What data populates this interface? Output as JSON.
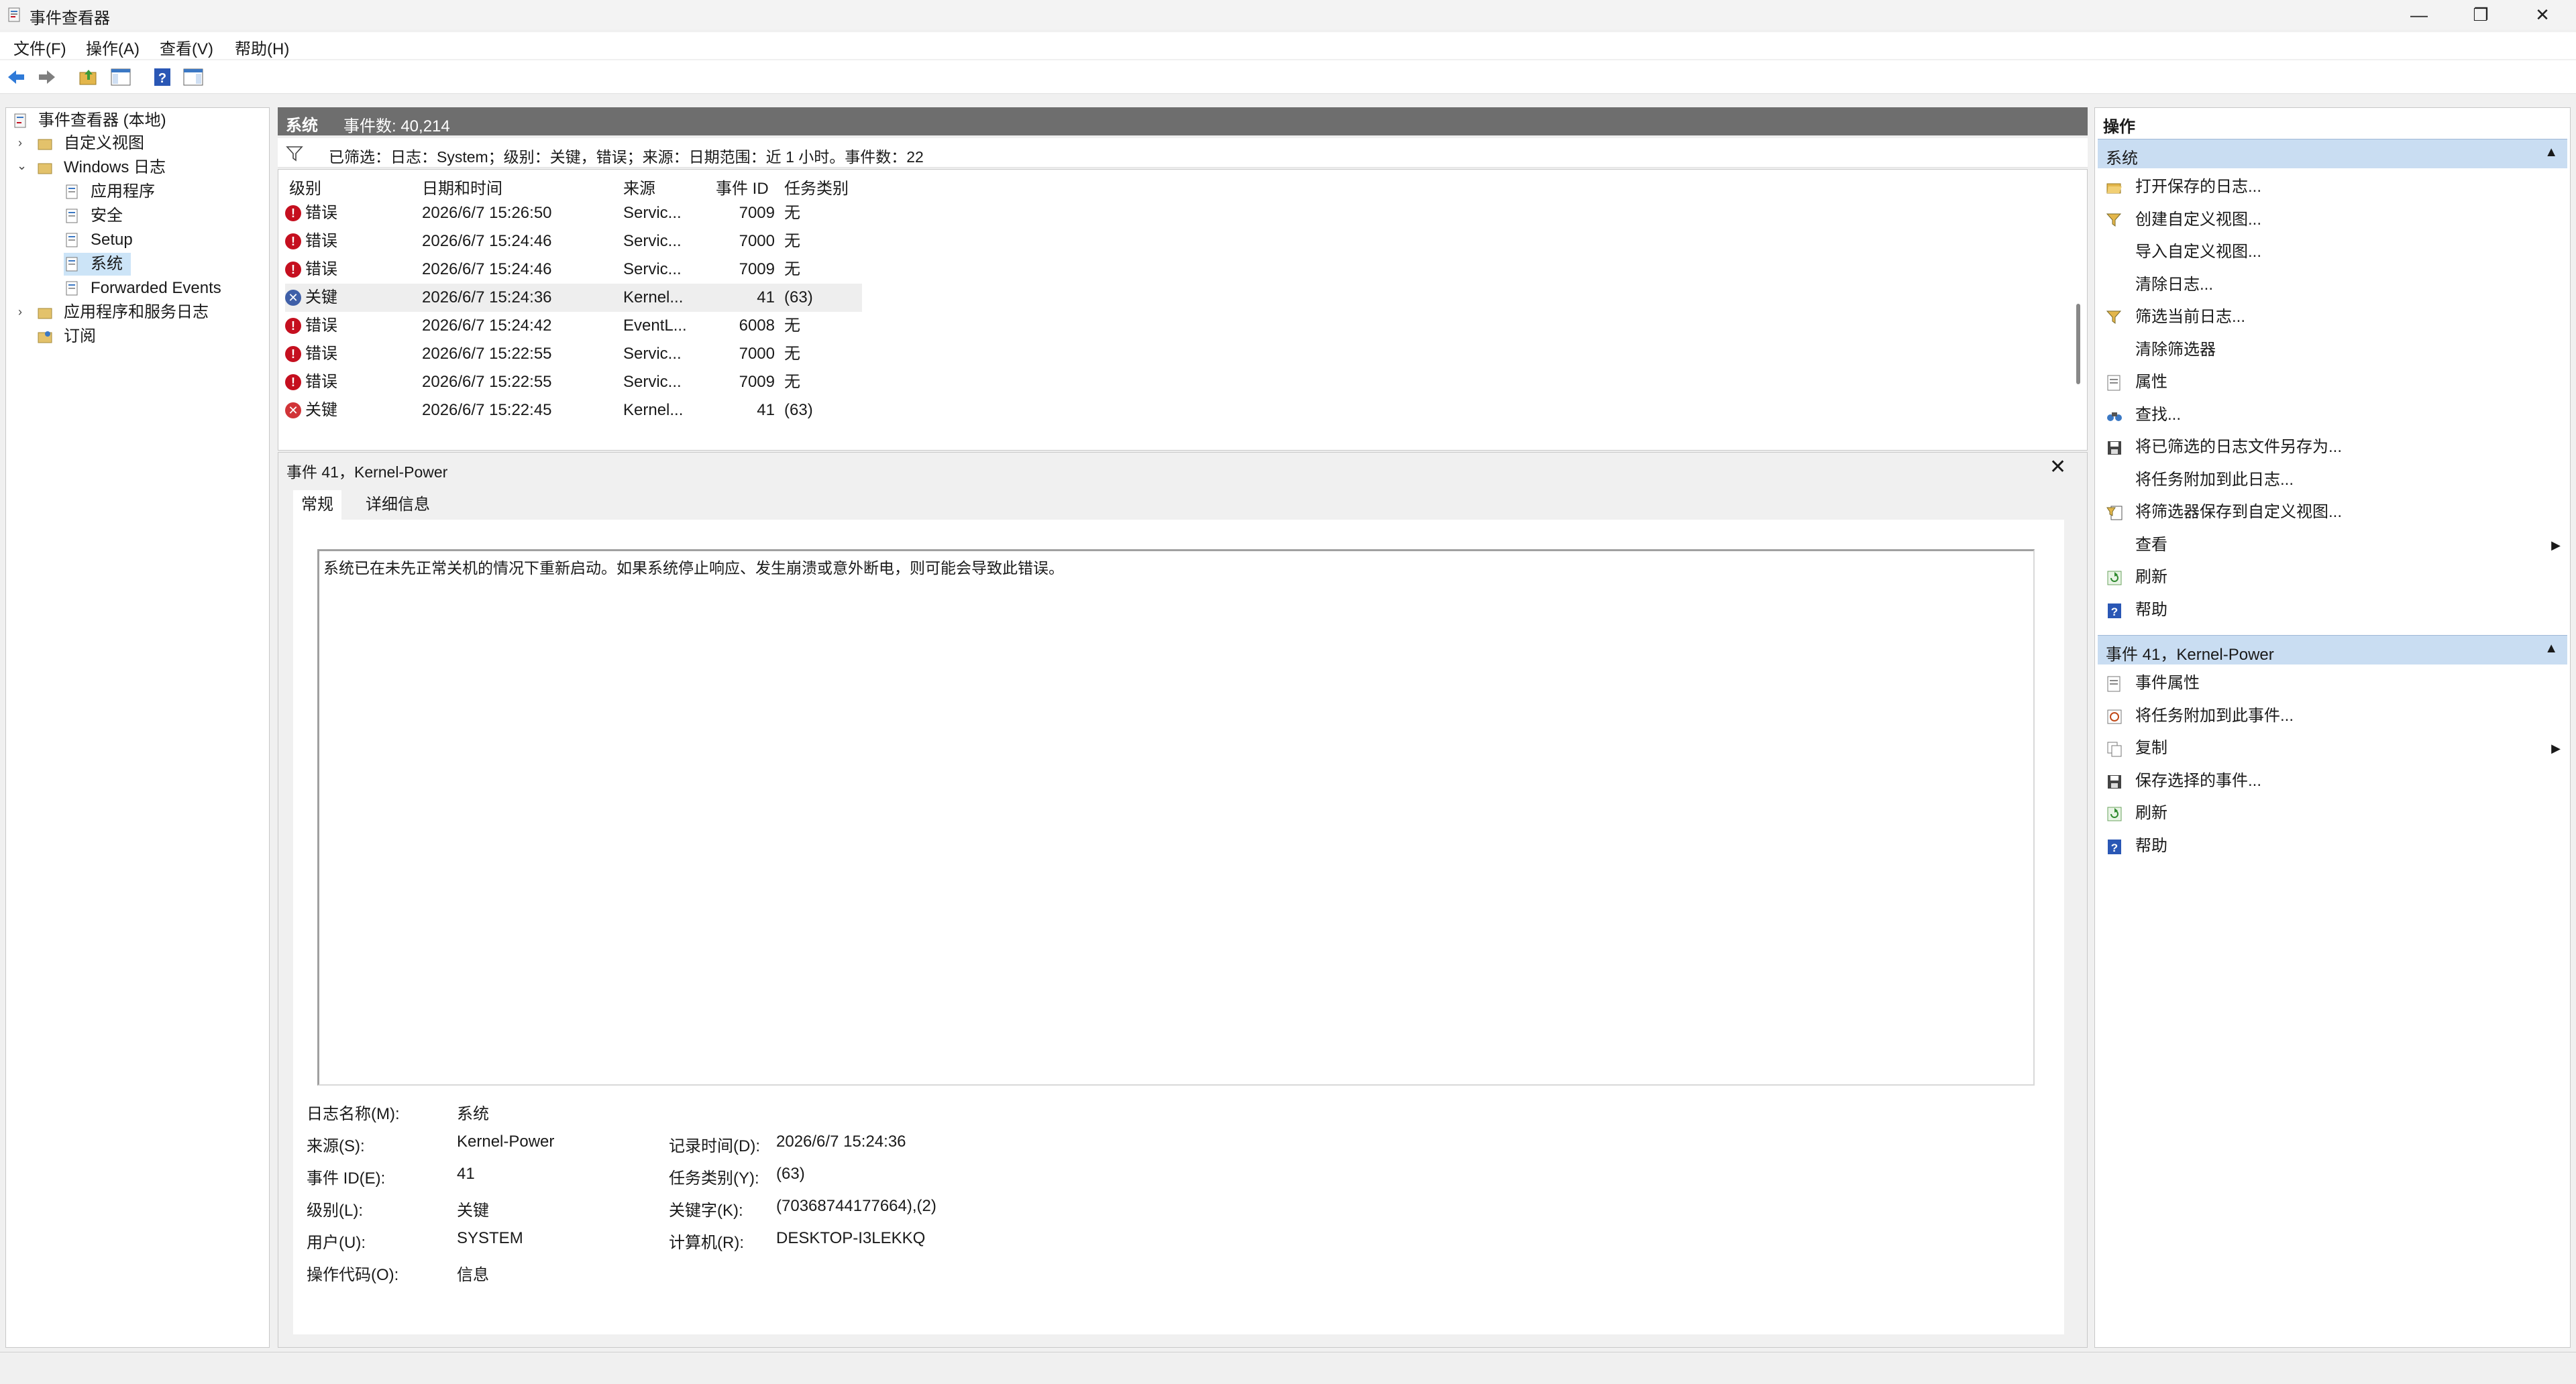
{
  "window": {
    "title": "事件查看器",
    "min_glyph": "—",
    "max_glyph": "❐",
    "close_glyph": "✕"
  },
  "menu": [
    "文件(F)",
    "操作(A)",
    "查看(V)",
    "帮助(H)"
  ],
  "toolbar": [
    "back-icon",
    "forward-icon",
    "up-folder-icon",
    "show-hide-tree-icon",
    "help-icon",
    "show-hide-action-pane-icon"
  ],
  "tree": {
    "root": "事件查看器 (本地)",
    "custom_views": "自定义视图",
    "windows_logs": "Windows 日志",
    "application": "应用程序",
    "security": "安全",
    "setup": "Setup",
    "system": "系统",
    "forwarded": "Forwarded Events",
    "app_service_logs": "应用程序和服务日志",
    "subscriptions": "订阅"
  },
  "middle": {
    "title": "系统",
    "count": "事件数: 40,214",
    "filter": "已筛选：日志：System；级别：关键，错误；来源：日期范围：近 1 小时。事件数：22",
    "columns": {
      "level": "级别",
      "datetime": "日期和时间",
      "source": "来源",
      "event_id": "事件 ID",
      "task": "任务类别"
    },
    "rows": [
      {
        "level": "错误",
        "kind": "error",
        "datetime": "2026/6/7 15:26:50",
        "source": "Servic...",
        "id": "7009",
        "task": "无"
      },
      {
        "level": "错误",
        "kind": "error",
        "datetime": "2026/6/7 15:24:46",
        "source": "Servic...",
        "id": "7000",
        "task": "无"
      },
      {
        "level": "错误",
        "kind": "error",
        "datetime": "2026/6/7 15:24:46",
        "source": "Servic...",
        "id": "7009",
        "task": "无"
      },
      {
        "level": "关键",
        "kind": "critical",
        "datetime": "2026/6/7 15:24:36",
        "source": "Kernel...",
        "id": "41",
        "task": "(63)"
      },
      {
        "level": "错误",
        "kind": "error",
        "datetime": "2026/6/7 15:24:42",
        "source": "EventL...",
        "id": "6008",
        "task": "无"
      },
      {
        "level": "错误",
        "kind": "error",
        "datetime": "2026/6/7 15:22:55",
        "source": "Servic...",
        "id": "7000",
        "task": "无"
      },
      {
        "level": "错误",
        "kind": "error",
        "datetime": "2026/6/7 15:22:55",
        "source": "Servic...",
        "id": "7009",
        "task": "无"
      },
      {
        "level": "关键",
        "kind": "critical",
        "datetime": "2026/6/7 15:22:45",
        "source": "Kernel...",
        "id": "41",
        "task": "(63)"
      }
    ]
  },
  "detail": {
    "title": "事件 41，Kernel-Power",
    "close": "✕",
    "tab_general": "常规",
    "tab_details": "详细信息",
    "description": "系统已在未先正常关机的情况下重新启动。如果系统停止响应、发生崩溃或意外断电，则可能会导致此错误。",
    "log_name_label": "日志名称(M):",
    "log_name": "系统",
    "source_label": "来源(S):",
    "source": "Kernel-Power",
    "logged_label": "记录时间(D):",
    "logged": "2026/6/7 15:24:36",
    "event_id_label": "事件 ID(E):",
    "event_id": "41",
    "task_label": "任务类别(Y):",
    "task": "(63)",
    "level_label": "级别(L):",
    "level": "关键",
    "keywords_label": "关键字(K):",
    "keywords": "(70368744177664),(2)",
    "user_label": "用户(U):",
    "user": "SYSTEM",
    "computer_label": "计算机(R):",
    "computer": "DESKTOP-I3LEKKQ",
    "opcode_label": "操作代码(O):",
    "opcode": "信息"
  },
  "actions": {
    "title": "操作",
    "section1": "系统",
    "section1_items": [
      {
        "label": "打开保存的日志...",
        "icon": "open-folder-icon"
      },
      {
        "label": "创建自定义视图...",
        "icon": "funnel-icon"
      },
      {
        "label": "导入自定义视图...",
        "icon": ""
      },
      {
        "label": "清除日志...",
        "icon": ""
      },
      {
        "label": "筛选当前日志...",
        "icon": "funnel-icon"
      },
      {
        "label": "清除筛选器",
        "icon": ""
      },
      {
        "label": "属性",
        "icon": "properties-icon"
      },
      {
        "label": "查找...",
        "icon": "binoculars-icon"
      },
      {
        "label": "将已筛选的日志文件另存为...",
        "icon": "save-icon"
      },
      {
        "label": "将任务附加到此日志...",
        "icon": ""
      },
      {
        "label": "将筛选器保存到自定义视图...",
        "icon": "save-filter-icon"
      },
      {
        "label": "查看",
        "icon": "",
        "submenu": true
      },
      {
        "label": "刷新",
        "icon": "refresh-icon"
      },
      {
        "label": "帮助",
        "icon": "help-icon"
      }
    ],
    "section2": "事件 41，Kernel-Power",
    "section2_items": [
      {
        "label": "事件属性",
        "icon": "properties-icon"
      },
      {
        "label": "将任务附加到此事件...",
        "icon": "task-icon"
      },
      {
        "label": "复制",
        "icon": "copy-icon",
        "submenu": true
      },
      {
        "label": "保存选择的事件...",
        "icon": "save-icon"
      },
      {
        "label": "刷新",
        "icon": "refresh-icon"
      },
      {
        "label": "帮助",
        "icon": "help-icon"
      }
    ],
    "collapse_glyph": "▲",
    "submenu_glyph": "▶"
  },
  "colors": {
    "error": "#c50f1f",
    "critical_bg": "#3f5fa8",
    "section_bg": "#c9ddf2",
    "header_bg": "#6e6e6e",
    "selected": "#cce4f7"
  }
}
